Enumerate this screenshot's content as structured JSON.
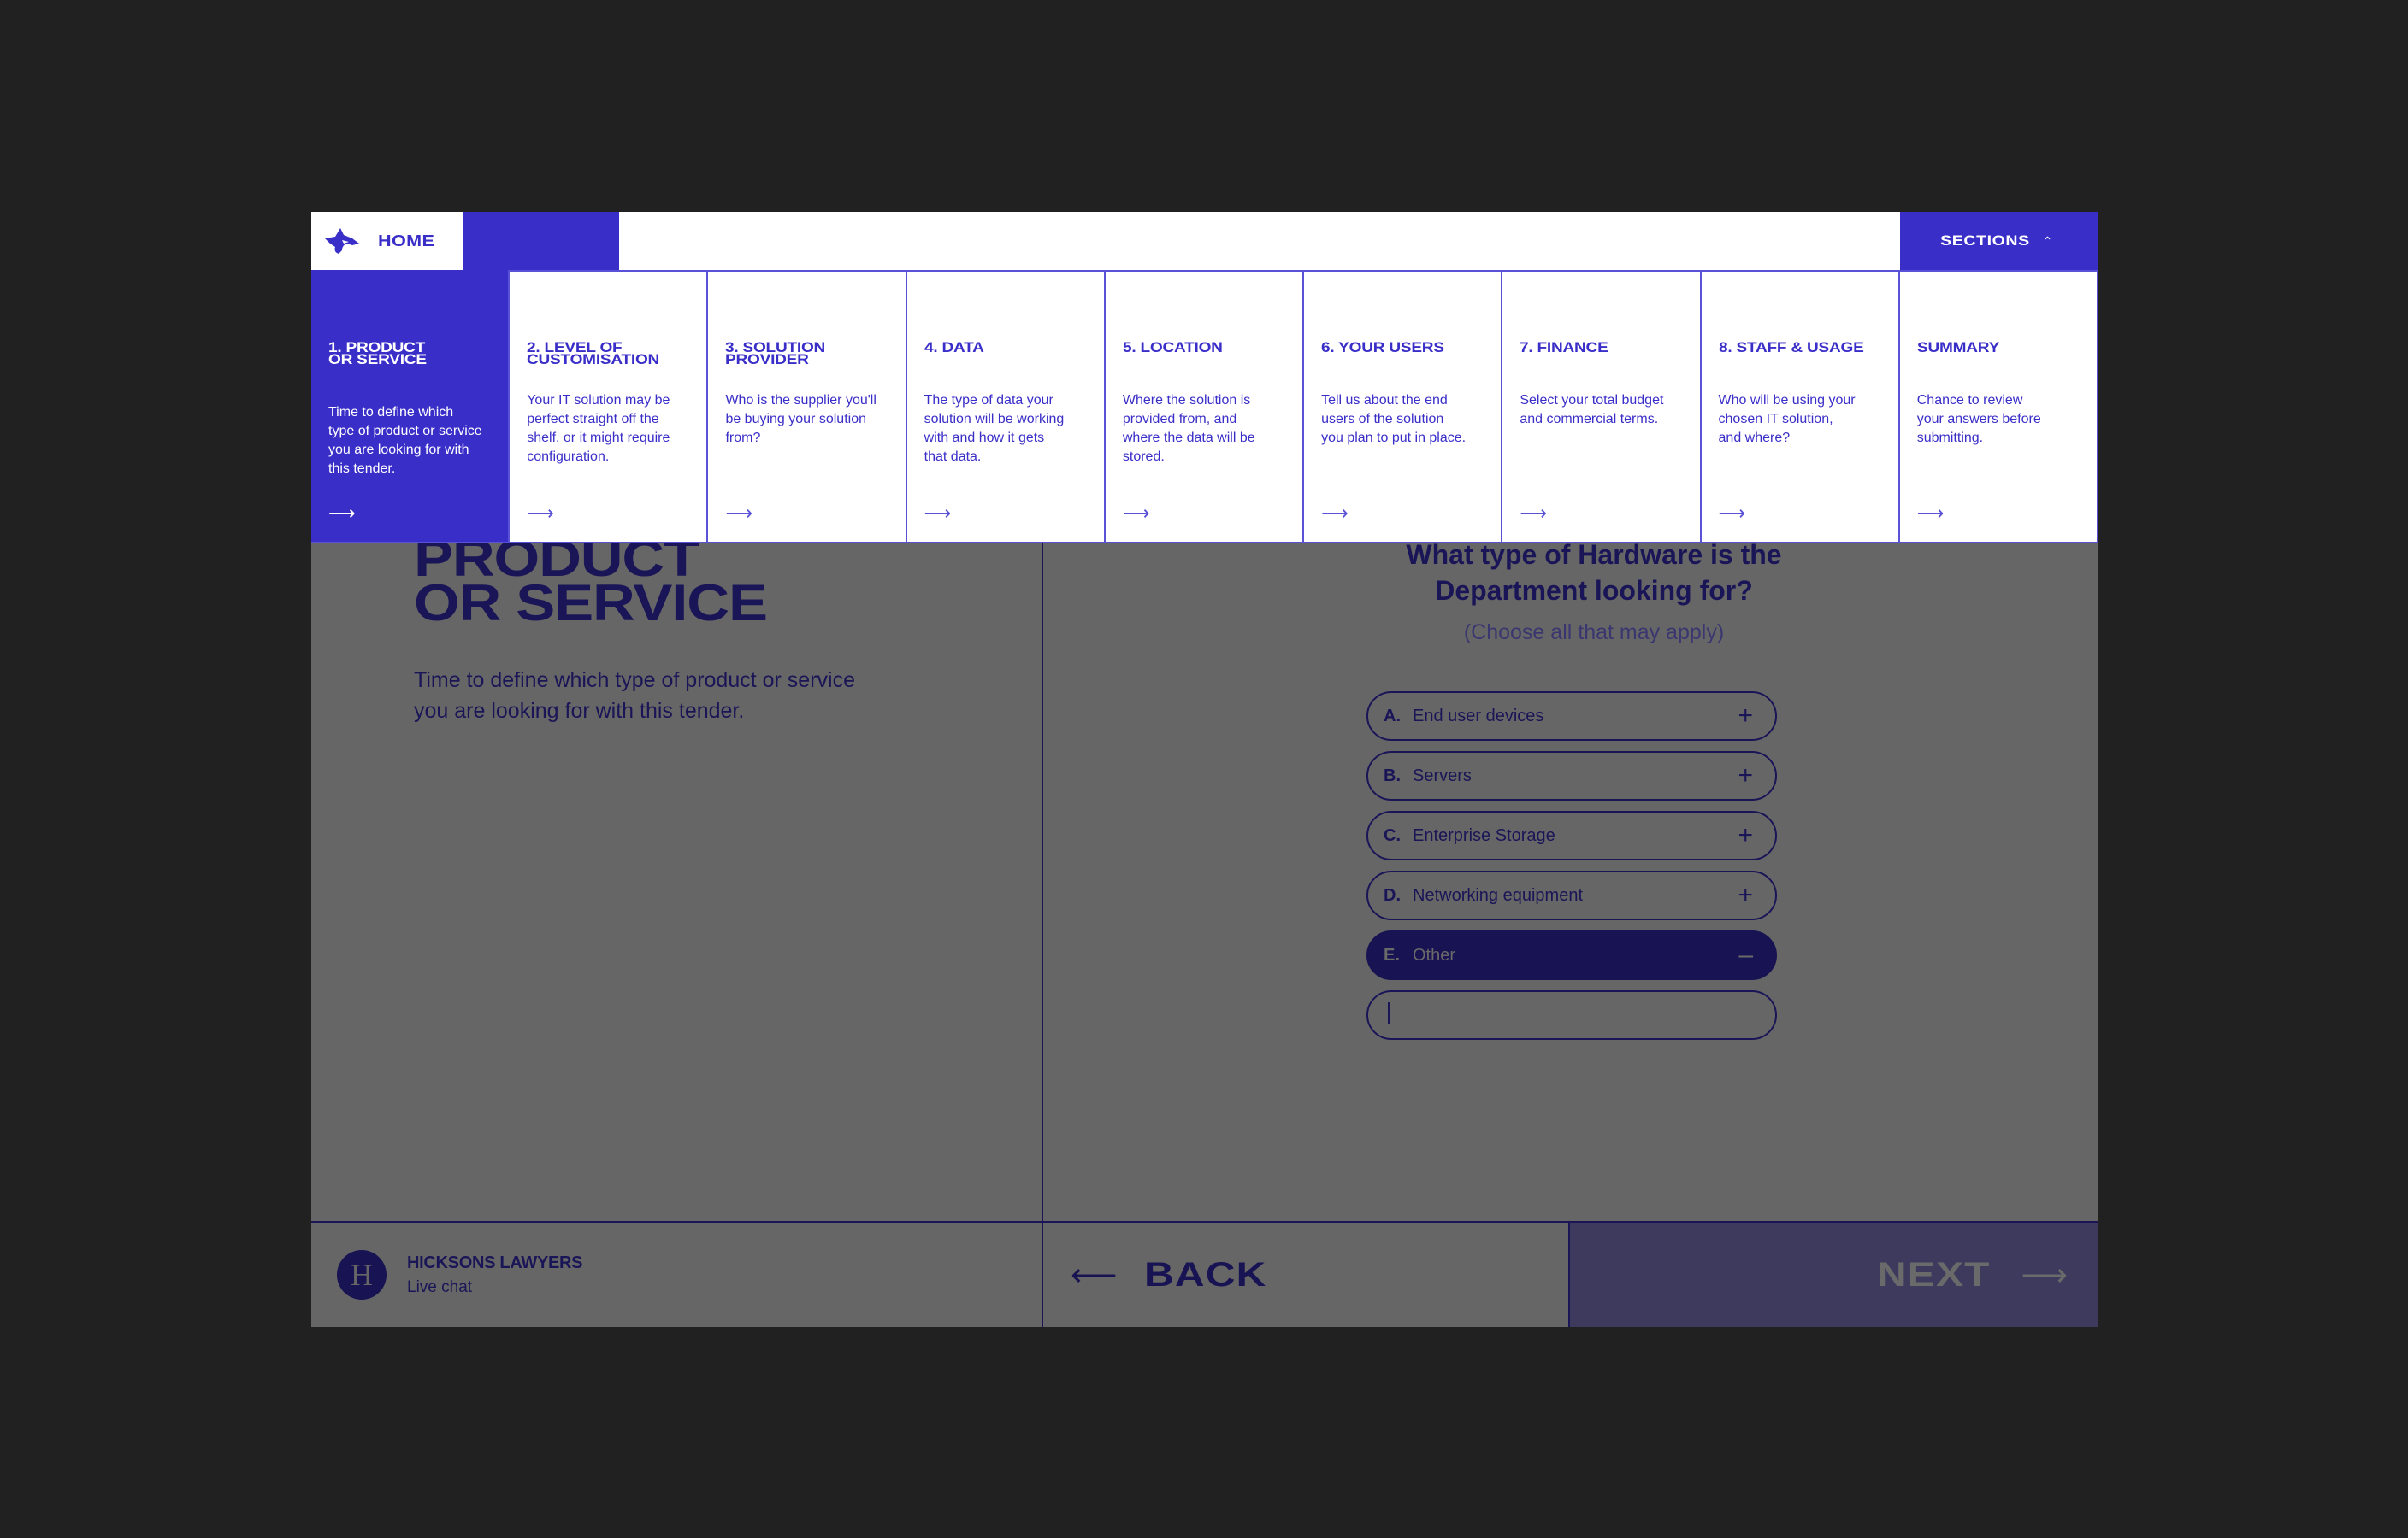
{
  "header": {
    "home_label": "HOME",
    "sections_label": "SECTIONS",
    "sections_icon": "chevron-up-icon"
  },
  "sections": [
    {
      "title": "1. PRODUCT\nOR SERVICE",
      "description": "Time to define which\ntype of product or service\nyou are looking for with\nthis tender.",
      "active": true
    },
    {
      "title": "2. LEVEL OF\nCUSTOMISATION",
      "description": "Your IT solution may be\nperfect straight off the\nshelf, or it might require\nconfiguration.",
      "active": false
    },
    {
      "title": "3. SOLUTION\nPROVIDER",
      "description": "Who is the supplier you'll\nbe buying your solution\nfrom?",
      "active": false
    },
    {
      "title": "4. DATA",
      "description": "The type of data your\nsolution will be working\nwith and how it gets\nthat data.",
      "active": false
    },
    {
      "title": "5. LOCATION",
      "description": "Where the solution is\nprovided from, and\nwhere the data will be\nstored.",
      "active": false
    },
    {
      "title": "6. YOUR USERS",
      "description": "Tell us about the end\nusers of the solution\nyou plan to put in place.",
      "active": false
    },
    {
      "title": "7. FINANCE",
      "description": "Select your total budget\nand commercial terms.",
      "active": false
    },
    {
      "title": "8. STAFF & USAGE",
      "description": "Who will be using your\nchosen IT solution,\nand where?",
      "active": false
    },
    {
      "title": "SUMMARY",
      "description": "Chance to review\nyour answers before\nsubmitting.",
      "active": false
    }
  ],
  "page": {
    "title": "PRODUCT\nOR SERVICE",
    "description": "Time to define which type of product or service you are looking for with this tender."
  },
  "question": {
    "text": "What type of Hardware is the Department looking for?",
    "hint": "(Choose all that may apply)",
    "options": [
      {
        "letter": "A.",
        "label": "End user devices",
        "sign": "+",
        "selected": false
      },
      {
        "letter": "B.",
        "label": "Servers",
        "sign": "+",
        "selected": false
      },
      {
        "letter": "C.",
        "label": "Enterprise Storage",
        "sign": "+",
        "selected": false
      },
      {
        "letter": "D.",
        "label": "Networking equipment",
        "sign": "+",
        "selected": false
      },
      {
        "letter": "E.",
        "label": "Other",
        "sign": "–",
        "selected": true
      }
    ],
    "other_value": "",
    "other_placeholder": ""
  },
  "footer": {
    "chat_avatar_letter": "H",
    "chat_name": "HICKSONS LAWYERS",
    "chat_status": "Live chat",
    "back_label": "BACK",
    "next_label": "NEXT",
    "back_arrow": "⟵",
    "next_arrow": "⟶"
  },
  "colors": {
    "brand": "#3a2ec8",
    "dark_brand": "#181352",
    "overlay_bg": "#666666",
    "page_bg": "#212121"
  }
}
